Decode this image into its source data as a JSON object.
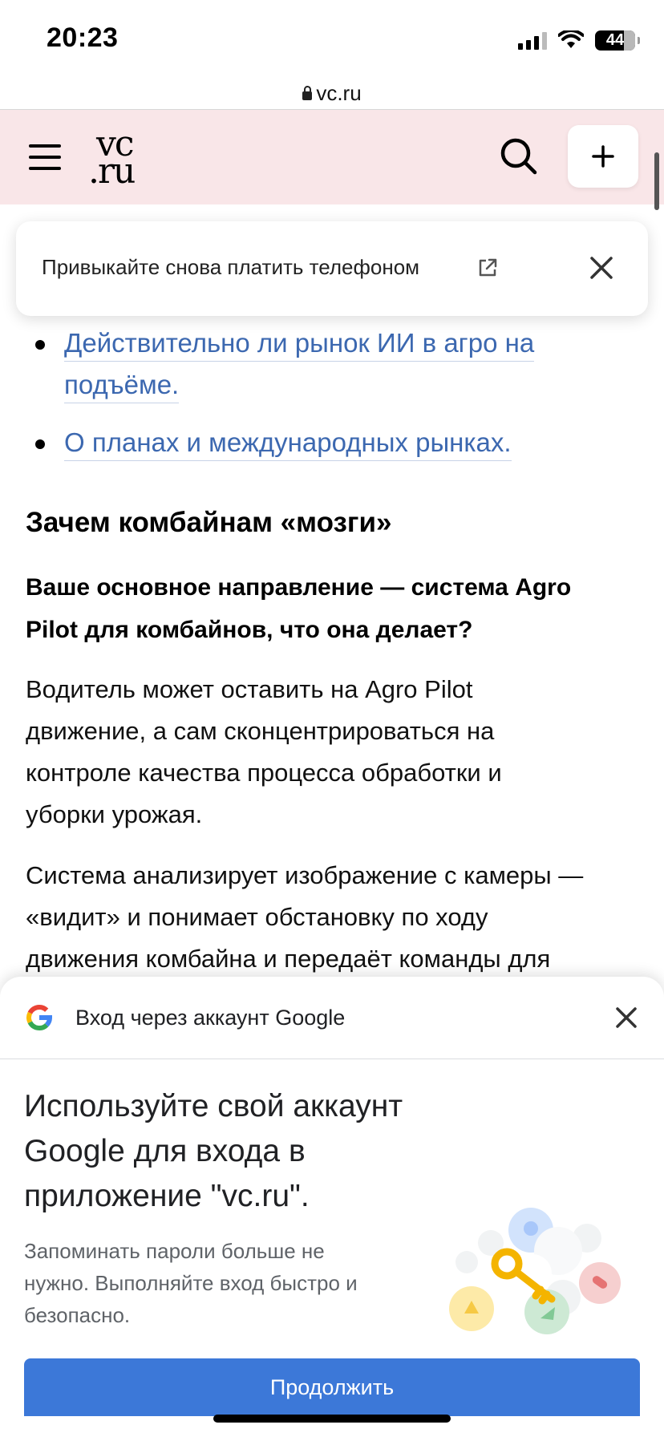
{
  "status_bar": {
    "time": "20:23",
    "battery": "44"
  },
  "browser": {
    "url": "vc.ru"
  },
  "header": {
    "logo_line1": "vc",
    "logo_line2": ".ru"
  },
  "banner": {
    "text": "Привыкайте снова платить телефоном"
  },
  "article": {
    "links": [
      {
        "line1": "Действительно ли рынок ИИ в агро на",
        "line2": "подъёме."
      },
      {
        "line1": "О планах и международных рынках."
      }
    ],
    "section_heading": "Зачем комбайнам «мозги»",
    "question_lines": [
      "Ваше основное направление — система Agro",
      "Pilot для комбайнов, что она делает?"
    ],
    "paragraph1_lines": [
      "Водитель может оставить на Agro Pilot",
      "движение, а сам сконцентрироваться на",
      "контроле качества процесса обработки и",
      "уборки урожая."
    ],
    "paragraph2_lines": [
      "Система анализирует изображение с камеры —",
      "«видит» и понимает обстановку по ходу",
      "движения комбайна и передаёт команды для"
    ]
  },
  "google_sheet": {
    "title": "Вход через аккаунт Google",
    "heading_lines": [
      "Используйте свой аккаунт",
      "Google для входа в",
      "приложение \"vc.ru\"."
    ],
    "description_lines": [
      "Запоминать пароли больше не",
      "нужно. Выполняйте вход быстро и",
      "безопасно."
    ],
    "continue_label": "Продолжить"
  },
  "colors": {
    "header_bg": "#f9e6e8",
    "link": "#3c68b0",
    "primary_button": "#3c78d8"
  }
}
